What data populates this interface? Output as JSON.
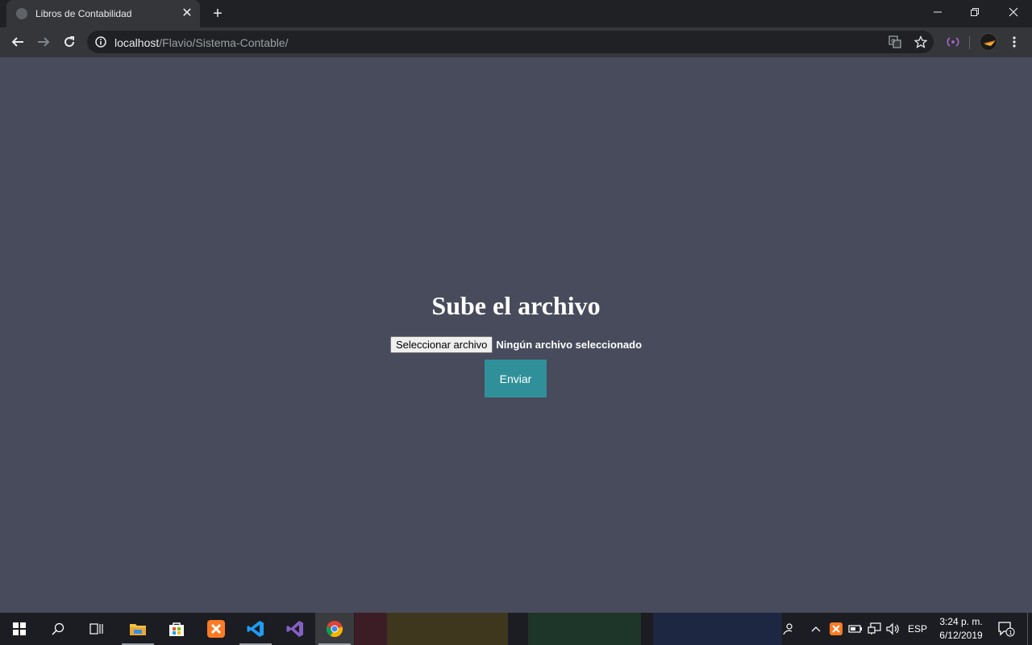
{
  "browser": {
    "tab_title": "Libros de Contabilidad",
    "url_host": "localhost",
    "url_path": "/Flavio/Sistema-Contable/"
  },
  "page": {
    "heading": "Sube el archivo",
    "file_button_label": "Seleccionar archivo",
    "file_status": "Ningún archivo seleccionado",
    "submit_label": "Enviar",
    "background_color": "#484b5b",
    "button_color": "#2f9099"
  },
  "taskbar": {
    "apps": [
      "start-icon",
      "search-icon",
      "task-view-icon",
      "file-explorer-icon",
      "store-icon",
      "xampp-icon",
      "vscode-icon",
      "visual-studio-icon",
      "chrome-icon"
    ],
    "language": "ESP",
    "time": "3:24 p. m.",
    "date": "6/12/2019",
    "notification_count": "1"
  }
}
